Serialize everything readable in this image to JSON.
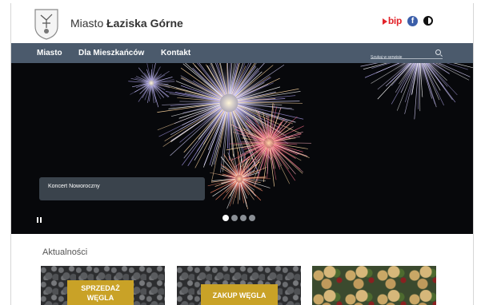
{
  "header": {
    "brand_prefix": "Miasto",
    "brand_name": "Łaziska Górne",
    "bip_label": "bip",
    "facebook_glyph": "f"
  },
  "nav": {
    "items": [
      "Miasto",
      "Dla Mieszkańców",
      "Kontakt"
    ],
    "search_placeholder": "Szukaj w serwisie"
  },
  "hero": {
    "caption": "Koncert Noworoczny",
    "slide_count": 4,
    "active_slide": 1
  },
  "news": {
    "title": "Aktualności",
    "cards": [
      {
        "label_line1": "SPRZEDAŻ",
        "label_line2": "WĘGLA"
      },
      {
        "label_line1": "ZAKUP WĘGLA",
        "label_line2": ""
      },
      {
        "label_line1": "",
        "label_line2": ""
      }
    ]
  },
  "colors": {
    "nav_bg": "#4b5a6c",
    "bip_red": "#e2232a",
    "facebook_blue": "#3b5ea9",
    "card_label_gold": "#c9a227"
  }
}
